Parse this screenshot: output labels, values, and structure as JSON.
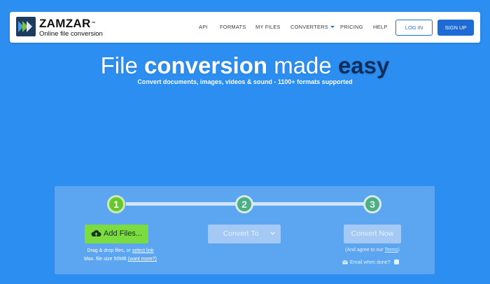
{
  "brand": {
    "name": "ZAMZAR",
    "trademark": "™",
    "tagline": "Online file conversion"
  },
  "nav": {
    "api": "API",
    "formats": "FORMATS",
    "my_files": "MY FILES",
    "converters": "CONVERTERS",
    "pricing": "PRICING",
    "help": "HELP",
    "login": "LOG IN",
    "signup": "SIGN UP"
  },
  "hero": {
    "title_part1": "File",
    "title_part2": "conversion",
    "title_part3": "made",
    "title_part4": "easy",
    "subtitle": "Convert documents, images, videos & sound - 1100+ formats supported"
  },
  "steps": {
    "step1": "1",
    "step2": "2",
    "step3": "3"
  },
  "upload": {
    "add_files_label": "Add Files...",
    "drag_text": "Drag & drop files, or",
    "select_link": "select link",
    "max_size_text": "Max. file size 50MB",
    "want_more_link": "(want more?)"
  },
  "convert_to": {
    "selected": "Convert To"
  },
  "convert_now": {
    "label": "Convert Now",
    "agree_text": "(And agree to our",
    "terms_link": "Terms",
    "agree_close": ")",
    "email_label": "Email when done?"
  },
  "colors": {
    "page_background": "#2b8ef0",
    "panel": "#5ba5f1",
    "accent_green": "#7bdc3f",
    "easy_text": "#0f2d5c",
    "button_blue": "#1f6bd5"
  },
  "icons": {
    "logo": "zamzar-arrow-logo",
    "upload": "cloud-upload-icon",
    "dropdown": "chevron-down-icon",
    "email": "envelope-icon"
  }
}
